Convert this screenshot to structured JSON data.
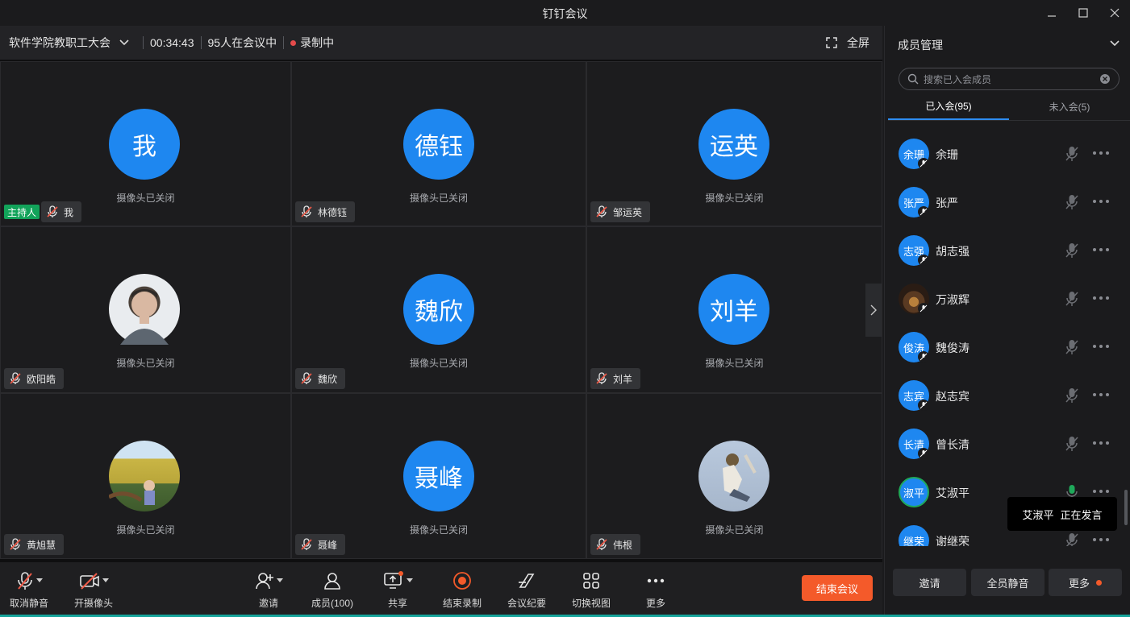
{
  "window": {
    "title": "钉钉会议"
  },
  "infobar": {
    "meeting_name": "软件学院教职工大会",
    "duration": "00:34:43",
    "participants": "95人在会议中",
    "recording": "录制中",
    "fullscreen": "全屏"
  },
  "tiles": [
    {
      "avatar_text": "我",
      "camera_status": "摄像头已关闭",
      "name": "我",
      "host_badge": "主持人",
      "avatar_type": "text"
    },
    {
      "avatar_text": "德钰",
      "camera_status": "摄像头已关闭",
      "name": "林德钰",
      "avatar_type": "text"
    },
    {
      "avatar_text": "运英",
      "camera_status": "摄像头已关闭",
      "name": "邹运英",
      "avatar_type": "text"
    },
    {
      "avatar_text": "",
      "camera_status": "摄像头已关闭",
      "name": "欧阳皓",
      "avatar_type": "photo-portrait"
    },
    {
      "avatar_text": "魏欣",
      "camera_status": "摄像头已关闭",
      "name": "魏欣",
      "avatar_type": "text"
    },
    {
      "avatar_text": "刘羊",
      "camera_status": "摄像头已关闭",
      "name": "刘羊",
      "avatar_type": "text"
    },
    {
      "avatar_text": "",
      "camera_status": "摄像头已关闭",
      "name": "黄旭慧",
      "avatar_type": "photo-field"
    },
    {
      "avatar_text": "聂峰",
      "camera_status": "摄像头已关闭",
      "name": "聂峰",
      "avatar_type": "text"
    },
    {
      "avatar_text": "",
      "camera_status": "摄像头已关闭",
      "name": "伟根",
      "avatar_type": "photo-sky"
    }
  ],
  "toolbar": {
    "unmute": "取消静音",
    "camera": "开摄像头",
    "invite": "邀请",
    "members": "成员(100)",
    "share": "共享",
    "end_recording": "结束录制",
    "minutes": "会议纪要",
    "switch_view": "切换视图",
    "more": "更多",
    "end_meeting": "结束会议"
  },
  "panel": {
    "title": "成员管理",
    "search_placeholder": "搜索已入会成员",
    "tab_joined": "已入会(95)",
    "tab_not_joined": "未入会(5)",
    "members": [
      {
        "avatar_text": "余珊",
        "name": "余珊",
        "mic": "muted"
      },
      {
        "avatar_text": "张严",
        "name": "张严",
        "mic": "muted"
      },
      {
        "avatar_text": "志强",
        "name": "胡志强",
        "mic": "muted"
      },
      {
        "avatar_text": "",
        "name": "万淑辉",
        "mic": "muted",
        "avatar_type": "photo"
      },
      {
        "avatar_text": "俊涛",
        "name": "魏俊涛",
        "mic": "muted"
      },
      {
        "avatar_text": "志宾",
        "name": "赵志宾",
        "mic": "muted"
      },
      {
        "avatar_text": "长清",
        "name": "曾长清",
        "mic": "muted"
      },
      {
        "avatar_text": "淑平",
        "name": "艾淑平",
        "mic": "speaking"
      },
      {
        "avatar_text": "继荣",
        "name": "谢继荣",
        "mic": "muted"
      }
    ],
    "tooltip_name": "艾淑平",
    "tooltip_status": "正在发言",
    "footer": {
      "invite": "邀请",
      "mute_all": "全员静音",
      "more": "更多"
    }
  },
  "colors": {
    "accent": "#1e87f0",
    "end_button": "#f45a2a",
    "host_badge": "#12a35a",
    "speaking_green": "#1fa85a"
  }
}
